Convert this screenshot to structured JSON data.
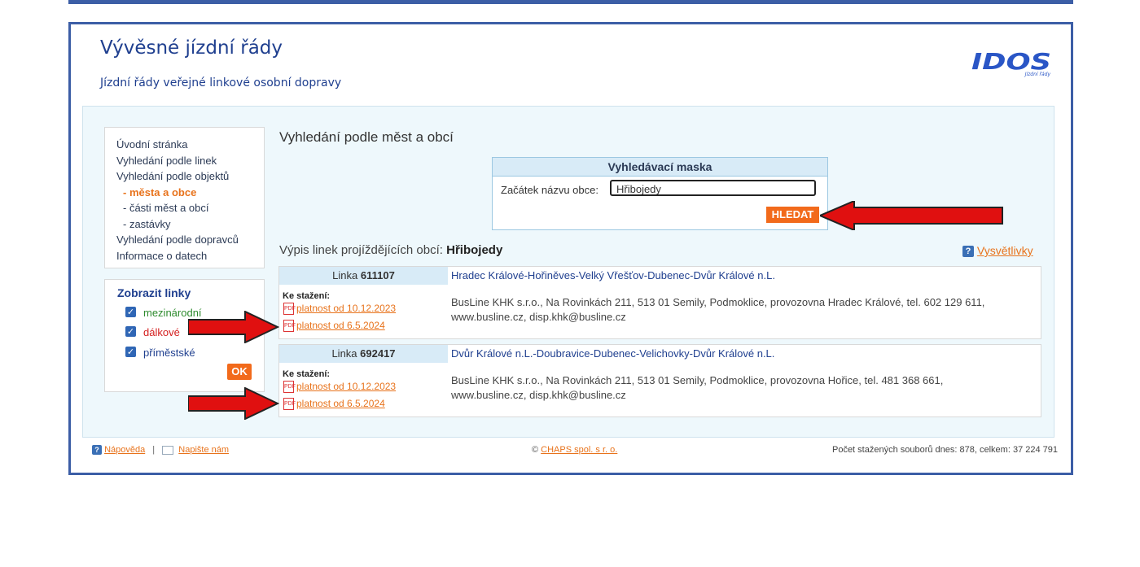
{
  "header": {
    "title": "Vývěsné jízdní řády",
    "subtitle": "Jízdní řády veřejné linkové osobní dopravy",
    "logo_text": "IDOS",
    "logo_sub": "Jízdní řády"
  },
  "sidebar": {
    "items": [
      {
        "label": "Úvodní stránka",
        "active": false
      },
      {
        "label": "Vyhledání podle linek",
        "active": false
      },
      {
        "label": "Vyhledání podle objektů",
        "active": false
      },
      {
        "label": "- města a obce",
        "active": true
      },
      {
        "label": "- části měst a obcí",
        "active": false
      },
      {
        "label": "- zastávky",
        "active": false
      },
      {
        "label": "Vyhledání podle dopravců",
        "active": false
      },
      {
        "label": "Informace o datech",
        "active": false
      }
    ]
  },
  "filters": {
    "title": "Zobrazit linky",
    "options": [
      {
        "label": "mezinárodní",
        "checked": true,
        "color": "#2e8b2e"
      },
      {
        "label": "dálkové",
        "checked": true,
        "color": "#d42020"
      },
      {
        "label": "příměstské",
        "checked": true,
        "color": "#1f3f8f"
      }
    ],
    "ok_label": "OK"
  },
  "main": {
    "heading": "Vyhledání podle měst a obcí",
    "search_mask": {
      "title": "Vyhledávací maska",
      "label": "Začátek názvu obce:",
      "value": "Hřibojedy",
      "button": "HLEDAT"
    },
    "list_prefix": "Výpis linek projíždějících obcí:",
    "list_town": "Hřibojedy",
    "help_link": "Vysvětlivky",
    "lines": [
      {
        "linka_label": "Linka",
        "number": "611107",
        "route": "Hradec Králové-Hořiněves-Velký Vřešťov-Dubenec-Dvůr Králové n.L.",
        "download_label": "Ke stažení:",
        "downloads": [
          "platnost od 10.12.2023",
          "platnost od 6.5.2024"
        ],
        "carrier": "BusLine KHK s.r.o., Na Rovinkách 211, 513 01 Semily, Podmoklice, provozovna Hradec Králové, tel. 602 129 611, www.busline.cz, disp.khk@busline.cz"
      },
      {
        "linka_label": "Linka",
        "number": "692417",
        "route": "Dvůr Králové n.L.-Doubravice-Dubenec-Velichovky-Dvůr Králové n.L.",
        "download_label": "Ke stažení:",
        "downloads": [
          "platnost od 10.12.2023",
          "platnost od 6.5.2024"
        ],
        "carrier": "BusLine KHK s.r.o., Na Rovinkách 211, 513 01 Semily, Podmoklice, provozovna Hořice, tel. 481 368 661, www.busline.cz, disp.khk@busline.cz"
      }
    ]
  },
  "footer": {
    "help": "Nápověda",
    "separator": "|",
    "write": "Napište nám",
    "copyright_symbol": "©",
    "company": "CHAPS spol. s r. o.",
    "stats": "Počet stažených souborů dnes: 878, celkem: 37 224 791"
  },
  "icons": {
    "help": "question-icon",
    "mail": "mail-icon",
    "pdf": "pdf-icon",
    "checkbox": "checkbox-icon",
    "arrow": "red-arrow-icon"
  },
  "colors": {
    "frame": "#3c5ea6",
    "accent": "#f26a1b",
    "panel": "#eef8fc"
  }
}
